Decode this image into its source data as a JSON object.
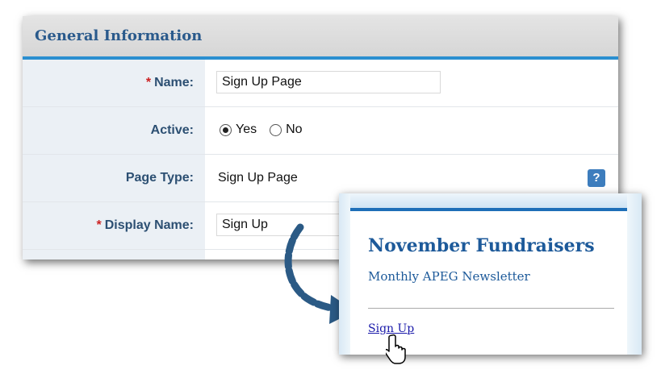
{
  "panel": {
    "title": "General Information",
    "fields": {
      "name": {
        "required_mark": "*",
        "label": "Name:",
        "value": "Sign Up Page"
      },
      "active": {
        "label": "Active:",
        "options": [
          "Yes",
          "No"
        ],
        "selected": "Yes"
      },
      "page_type": {
        "label": "Page Type:",
        "value": "Sign Up Page",
        "help": "?"
      },
      "display_name": {
        "required_mark": "*",
        "label": "Display Name:",
        "value": "Sign Up"
      }
    }
  },
  "preview": {
    "title": "November Fundraisers",
    "subtitle": "Monthly APEG Newsletter",
    "link": "Sign Up"
  },
  "colors": {
    "accent_blue": "#2b8fd0",
    "label_text": "#2c4f72",
    "required": "#cc2222",
    "preview_heading": "#1d5a9a",
    "arrow": "#2b5a85"
  }
}
